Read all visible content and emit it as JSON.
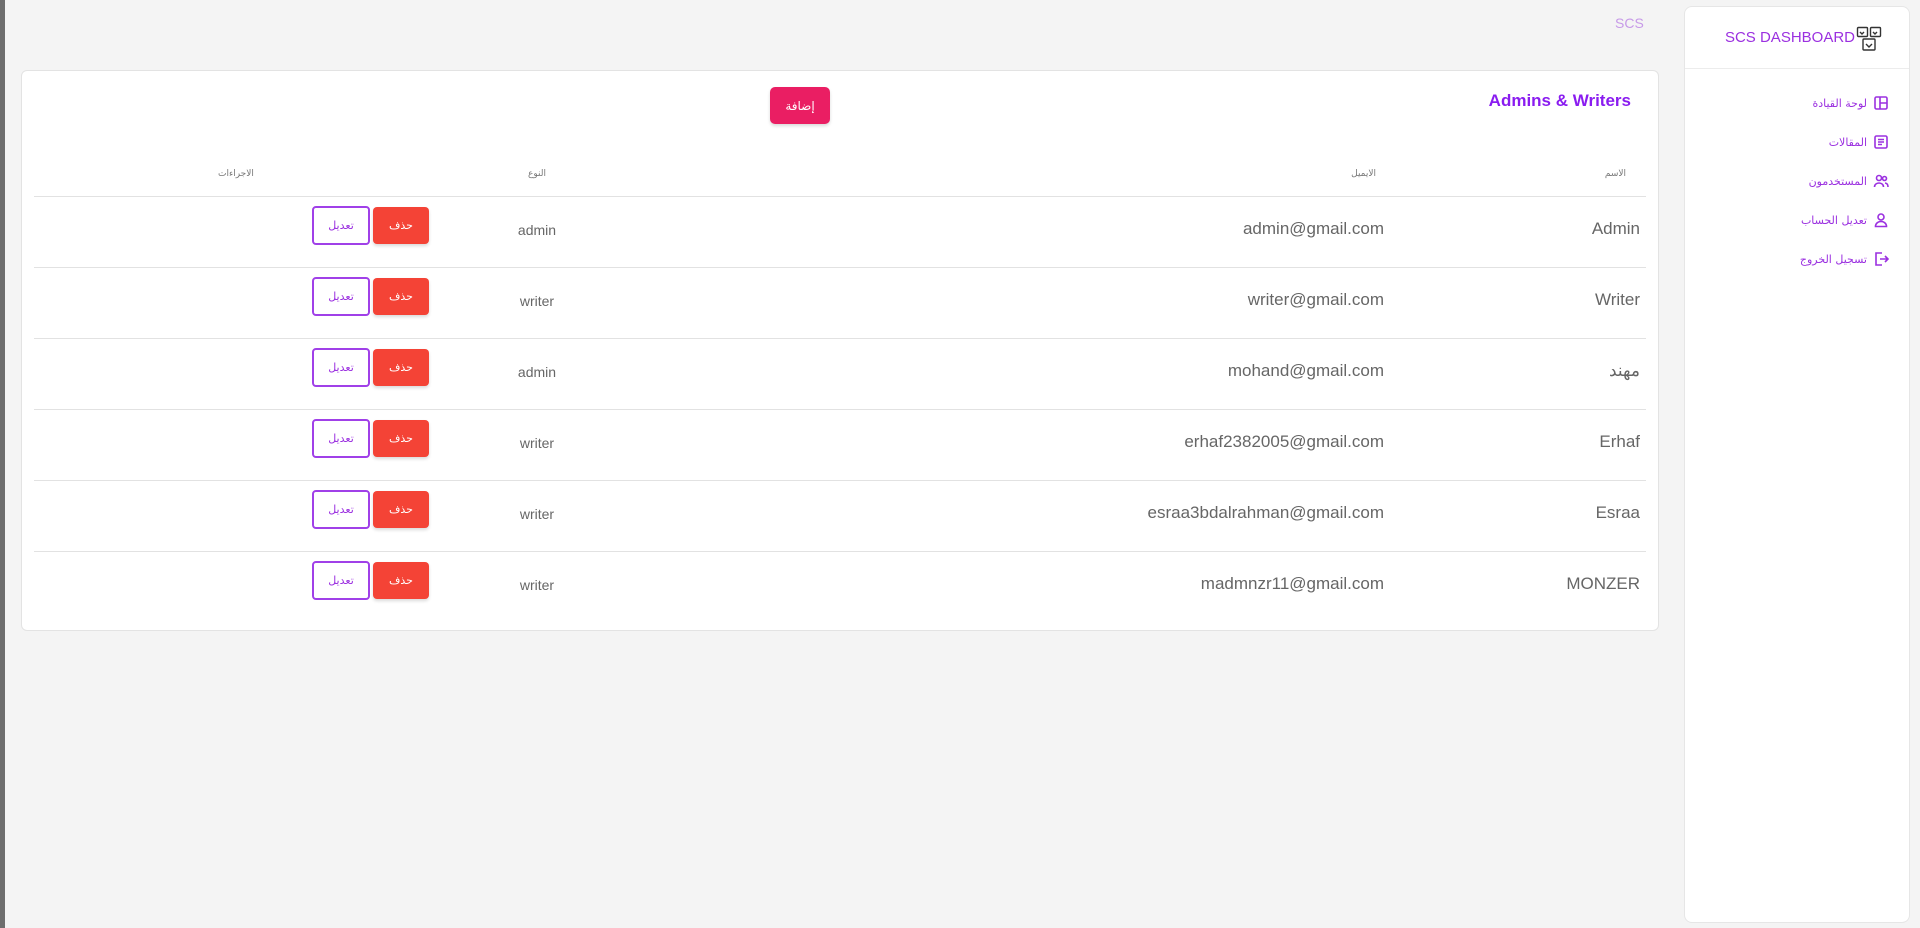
{
  "topbar": {
    "label": "SCS"
  },
  "sidebar": {
    "brand": "SCS DASHBOARD",
    "items": [
      {
        "label": "لوحة القيادة",
        "icon": "dashboard-icon"
      },
      {
        "label": "المقالات",
        "icon": "articles-icon"
      },
      {
        "label": "المستخدمون",
        "icon": "users-icon"
      },
      {
        "label": "تعديل الحساب",
        "icon": "user-icon"
      },
      {
        "label": "تسجيل الخروج",
        "icon": "logout-icon"
      }
    ]
  },
  "main": {
    "title": "Admins & Writers",
    "add_label": "إضافة",
    "headers": {
      "name": "الاسم",
      "email": "الايميل",
      "type": "النوع",
      "actions": "الاجراءات"
    },
    "delete_label": "حذف",
    "edit_label": "تعديل",
    "rows": [
      {
        "name": "Admin",
        "email": "admin@gmail.com",
        "type": "admin"
      },
      {
        "name": "Writer",
        "email": "writer@gmail.com",
        "type": "writer"
      },
      {
        "name": "مهند",
        "email": "mohand@gmail.com",
        "type": "admin"
      },
      {
        "name": "Erhaf",
        "email": "erhaf2382005@gmail.com",
        "type": "writer"
      },
      {
        "name": "Esraa",
        "email": "esraa3bdalrahman@gmail.com",
        "type": "writer"
      },
      {
        "name": "MONZER",
        "email": "madmnzr11@gmail.com",
        "type": "writer"
      }
    ]
  },
  "colors": {
    "accent": "#9b30e0",
    "add": "#ea1e63",
    "delete": "#f44336"
  }
}
